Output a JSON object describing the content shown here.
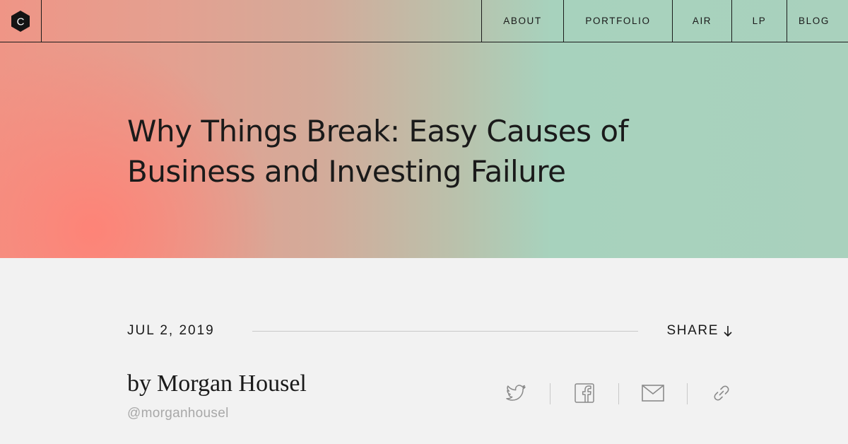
{
  "brand": {
    "logo_letter": "C",
    "logo_icon": "hexagon-logo-icon"
  },
  "nav": {
    "items": [
      {
        "label": "ABOUT"
      },
      {
        "label": "PORTFOLIO"
      },
      {
        "label": "AIR"
      },
      {
        "label": "LP"
      },
      {
        "label": "BLOG"
      }
    ]
  },
  "article": {
    "title": "Why Things Break: Easy Causes of Business and Investing Failure",
    "date": "JUL 2, 2019",
    "share_label": "SHARE",
    "share_icon": "arrow-down-icon",
    "author_prefix": "by",
    "author_name": "Morgan Housel",
    "author_handle": "@morganhousel"
  },
  "share_icons": [
    "twitter-icon",
    "facebook-icon",
    "email-icon",
    "link-icon"
  ],
  "colors": {
    "hero_left": "#ef9586",
    "hero_right": "#a9d1bd",
    "hero_glow": "#ff8276",
    "text": "#1a1a1a",
    "muted": "#a8a8a8",
    "page_bg": "#f2f2f2",
    "icon": "#8a8a8a"
  }
}
